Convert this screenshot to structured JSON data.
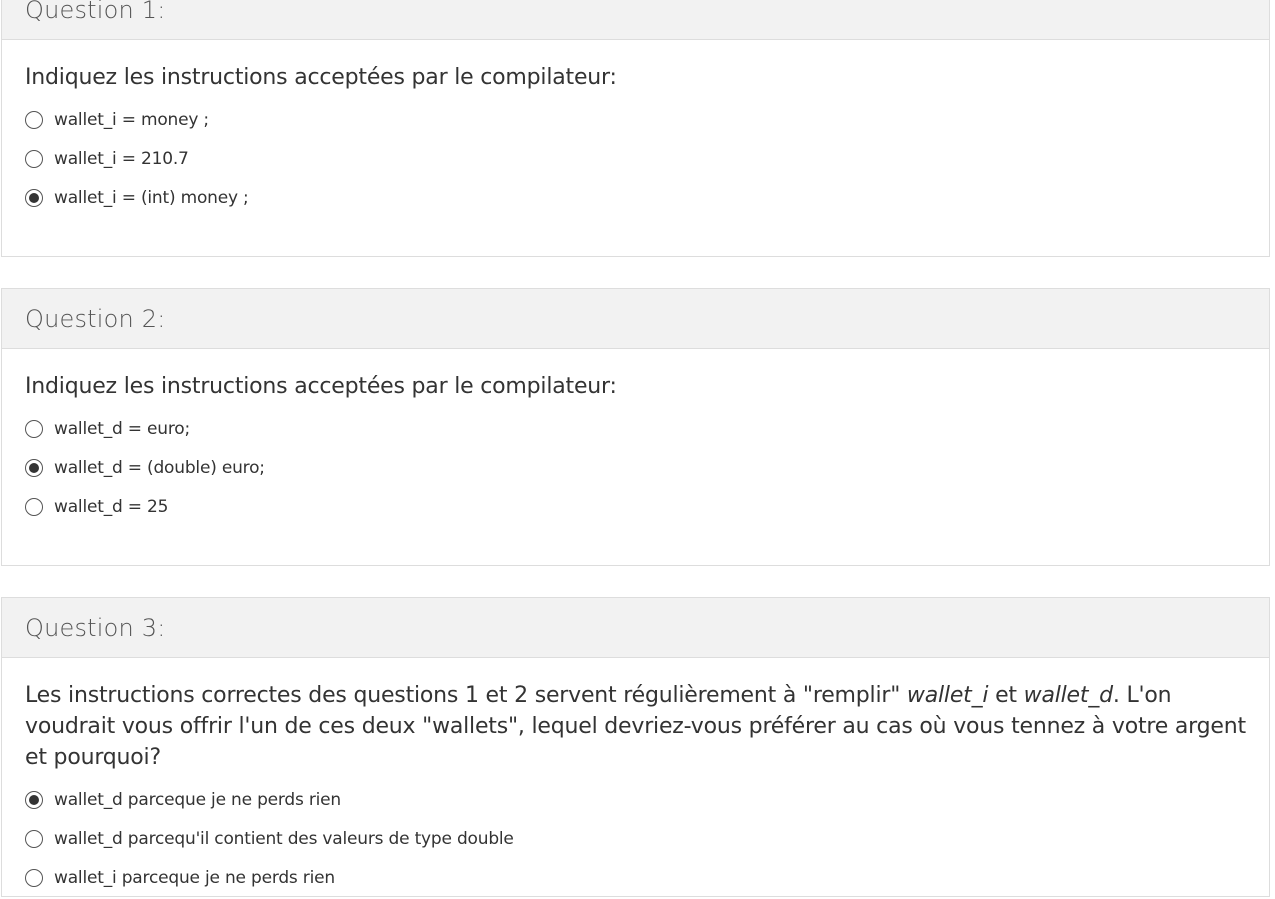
{
  "questions": [
    {
      "title": "Question 1:",
      "prompt": "Indiquez les instructions acceptées par le compilateur:",
      "options": [
        {
          "label": "wallet_i = money ;",
          "selected": false
        },
        {
          "label": "wallet_i = 210.7",
          "selected": false
        },
        {
          "label": "wallet_i = (int) money ;",
          "selected": true
        }
      ]
    },
    {
      "title": "Question 2:",
      "prompt": "Indiquez les instructions acceptées par le compilateur:",
      "options": [
        {
          "label": "wallet_d = euro;",
          "selected": false
        },
        {
          "label": "wallet_d = (double) euro;",
          "selected": true
        },
        {
          "label": "wallet_d = 25",
          "selected": false
        }
      ]
    },
    {
      "title": "Question 3:",
      "prompt_parts": {
        "part1": "Les instructions correctes des questions 1 et 2 servent régulièrement à \"remplir\" ",
        "var1": "wallet_i",
        "part2": " et ",
        "var2": "wallet_d",
        "part3": ". L'on voudrait vous offrir l'un de ces deux \"wallets\", lequel devriez-vous préférer au cas où vous tennez à votre argent et pourquoi?"
      },
      "options": [
        {
          "label": "wallet_d parceque je ne perds rien",
          "selected": true
        },
        {
          "label": "wallet_d parcequ'il contient des valeurs de type double",
          "selected": false
        },
        {
          "label": "wallet_i parceque je ne perds rien",
          "selected": false
        }
      ]
    }
  ]
}
